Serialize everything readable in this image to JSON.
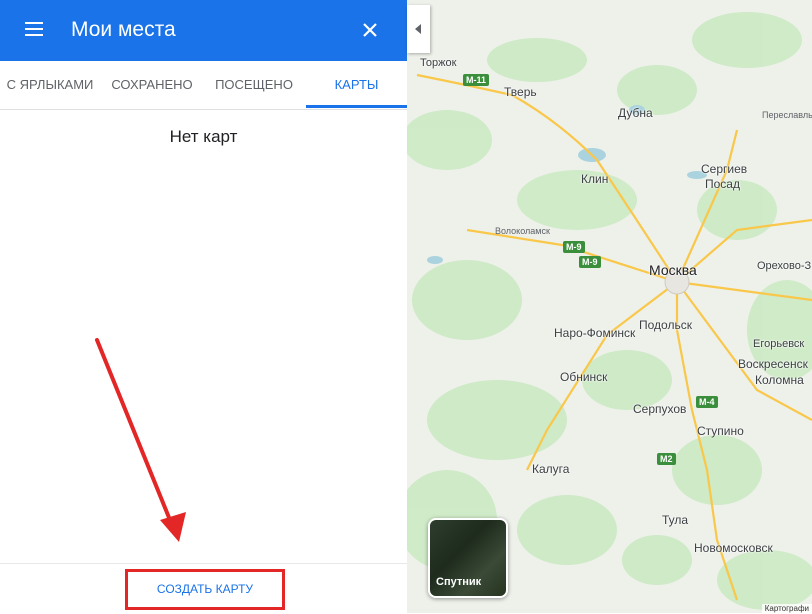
{
  "header": {
    "title": "Мои места",
    "menu_icon": "hamburger-menu-icon",
    "close_icon": "close-icon"
  },
  "tabs": [
    {
      "label": "С ЯРЛЫКАМИ"
    },
    {
      "label": "СОХРАНЕНО"
    },
    {
      "label": "ПОСЕЩЕНО"
    },
    {
      "label": "КАРТЫ",
      "active": true
    }
  ],
  "main": {
    "empty_text": "Нет карт"
  },
  "footer": {
    "create_map_label": "СОЗДАТЬ КАРТУ"
  },
  "map": {
    "labels": {
      "torzhok": "Торжок",
      "tver": "Тверь",
      "dubna": "Дубна",
      "pereslavl": "Переславль-З",
      "sergiev_posad_1": "Сергиев",
      "sergiev_posad_2": "Посад",
      "klin": "Клин",
      "volokolamsk": "Волоколамск",
      "moscow": "Москва",
      "orekhovo": "Орехово-З",
      "naro_fominsk": "Наро-Фоминск",
      "podolsk": "Подольск",
      "egorievsk": "Егорьевск",
      "voskresensk": "Воскресенск",
      "kolomna": "Коломна",
      "obninsk": "Обнинск",
      "serpukhov": "Серпухов",
      "stupino": "Ступино",
      "kaluga": "Калуга",
      "tula": "Тула",
      "novomoskovsk": "Новомосковск"
    },
    "roads": {
      "m11": "М-11",
      "m9a": "М-9",
      "m9b": "М-9",
      "m4": "М-4",
      "m2": "М2"
    },
    "satellite_label": "Спутник",
    "attribution": "Картографи"
  },
  "colors": {
    "accent": "#1a73e8",
    "highlight": "#e32626",
    "road_shield": "#3b8e3b"
  }
}
